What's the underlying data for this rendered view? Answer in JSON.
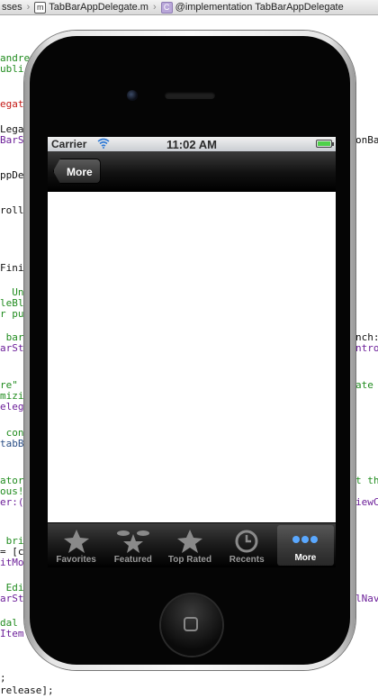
{
  "jumpbar": {
    "seg1": "sses",
    "seg2_icon": "m",
    "seg2": "TabBarAppDelegate.m",
    "seg3_icon": "C",
    "seg3": "@implementation TabBarAppDelegate"
  },
  "code": {
    "l1": "andrea",
    "l2": "ubli",
    "l3": "egate.",
    "l4": "Legat",
    "l5": "BarSt",
    "l6": "ppDe",
    "l7": "rolle",
    "l8": "Finis",
    "l9": "  Unc",
    "l10": "leBl",
    "l11": "r pu",
    "l12": " bar'",
    "l13": "arSt",
    "l14": "re\"",
    "l15": "mizin",
    "l16": "elega",
    "l17": " cont",
    "l18": "tabB",
    "l19": "ator,",
    "l20": "ous!",
    "l21": "er:(U",
    "l22": " bri",
    "l23": "= [co",
    "l24": "itMo",
    "l25": " Edit",
    "l26": "arSt",
    "l27": "dal",
    "l28": "Item",
    "l29": ";",
    "l30": "release];",
    "r1": "onBa",
    "r2": "nch:",
    "r3": "ntro",
    "r4": "ate",
    "r5": "t th",
    "r6": "iewC",
    "r7": "lNav"
  },
  "status": {
    "carrier": "Carrier",
    "time": "11:02 AM",
    "battery_level": 1.0
  },
  "navbar": {
    "back_label": "More"
  },
  "tabs": [
    {
      "label": "Favorites",
      "icon": "star-icon",
      "active": false
    },
    {
      "label": "Featured",
      "icon": "featured-icon",
      "active": false
    },
    {
      "label": "Top Rated",
      "icon": "star-icon",
      "active": false
    },
    {
      "label": "Recents",
      "icon": "clock-icon",
      "active": false
    },
    {
      "label": "More",
      "icon": "more-dots-icon",
      "active": true
    }
  ],
  "colors": {
    "tab_active_text": "#ffffff",
    "tab_inactive_text": "#9a9a9a",
    "battery": "#4fd14a"
  }
}
